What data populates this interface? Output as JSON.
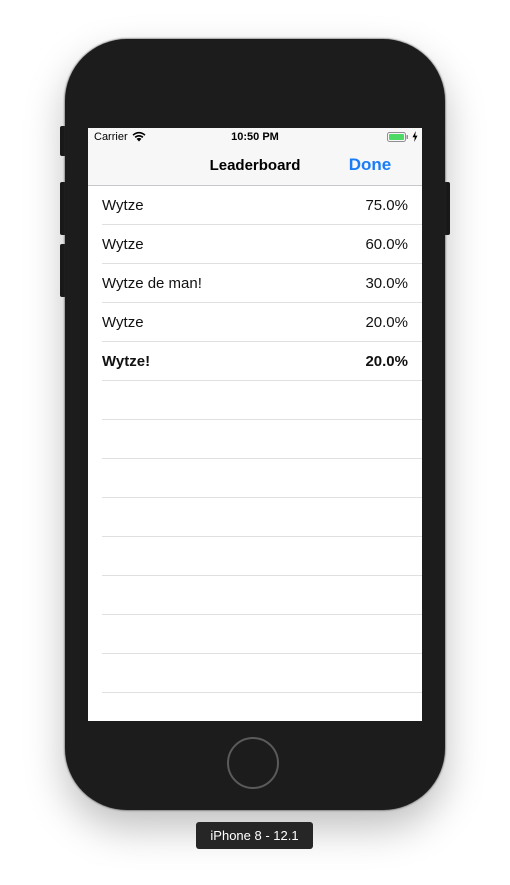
{
  "status_bar": {
    "carrier": "Carrier",
    "time": "10:50 PM",
    "battery_color": "#4cd964"
  },
  "nav": {
    "title": "Leaderboard",
    "done_label": "Done",
    "accent_color": "#1a7cf6"
  },
  "leaderboard": {
    "rows": [
      {
        "name": "Wytze",
        "score": "75.0%",
        "bold": false
      },
      {
        "name": "Wytze",
        "score": "60.0%",
        "bold": false
      },
      {
        "name": "Wytze de man!",
        "score": "30.0%",
        "bold": false
      },
      {
        "name": "Wytze",
        "score": "20.0%",
        "bold": false
      },
      {
        "name": "Wytze!",
        "score": "20.0%",
        "bold": true
      }
    ],
    "empty_row_count": 9
  },
  "device": {
    "label": "iPhone 8 - 12.1"
  }
}
